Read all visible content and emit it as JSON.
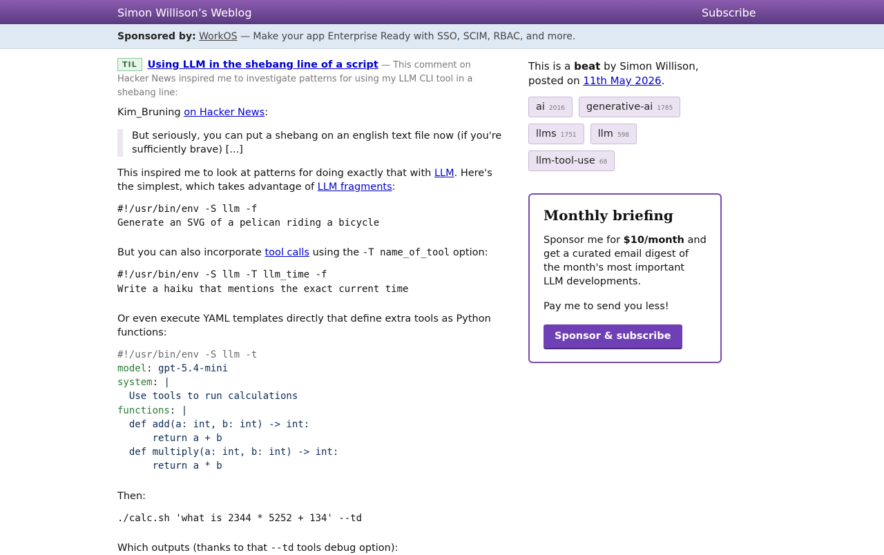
{
  "header": {
    "site_title": "Simon Willison’s Weblog",
    "subscribe": "Subscribe"
  },
  "sponsor_bar": {
    "label": "Sponsored by:",
    "sponsor": "WorkOS",
    "text": " — Make your app Enterprise Ready with SSO, SCIM, RBAC, and more."
  },
  "post": {
    "badge": "TIL",
    "title": "Using LLM in the shebang line of a script",
    "summary": " — This comment on Hacker News inspired me to investigate patterns for using my LLM CLI tool in a shebang line:",
    "source_author": "Kim_Bruning",
    "source_link": "on Hacker News",
    "quote": "But seriously, you can put a shebang on an english text file now (if you're sufficiently brave) [...]",
    "p1_a": "This inspired me to look at patterns for doing exactly that with ",
    "p1_link1": "LLM",
    "p1_b": ". Here's the simplest, which takes advantage of ",
    "p1_link2": "LLM fragments",
    "p1_c": ":",
    "code1": "#!/usr/bin/env -S llm -f\nGenerate an SVG of a pelican riding a bicycle",
    "p2_a": "But you can also incorporate ",
    "p2_link": "tool calls",
    "p2_b": " using the ",
    "p2_code": "-T name_of_tool",
    "p2_c": " option:",
    "code2": "#!/usr/bin/env -S llm -T llm_time -f\nWrite a haiku that mentions the exact current time",
    "p3": "Or even execute YAML templates directly that define extra tools as Python functions:",
    "code3": {
      "shebang": "#!/usr/bin/env -S llm -t",
      "model_key": "model",
      "model_val": "gpt-5.4-mini",
      "system_key": "system",
      "system_val": "|",
      "system_body": "  Use tools to run calculations",
      "functions_key": "functions",
      "functions_val": "|",
      "fn_body": "  def add(a: int, b: int) -> int:\n      return a + b\n  def multiply(a: int, b: int) -> int:\n      return a * b"
    },
    "p4": "Then:",
    "code4": "./calc.sh 'what is 2344 * 5252 + 134' --td",
    "p5_a": "Which outputs (thanks to that ",
    "p5_code": "--td",
    "p5_b": " tools debug option):"
  },
  "sidebar": {
    "beat_a": "This is a ",
    "beat_b": "beat",
    "beat_c": " by Simon Willison, posted on ",
    "date": "11th May 2026",
    "beat_d": ".",
    "tags": [
      {
        "label": "ai",
        "count": "2016"
      },
      {
        "label": "generative-ai",
        "count": "1785"
      },
      {
        "label": "llms",
        "count": "1751"
      },
      {
        "label": "llm",
        "count": "598"
      },
      {
        "label": "llm-tool-use",
        "count": "68"
      }
    ],
    "briefing": {
      "title": "Monthly briefing",
      "text_a": "Sponsor me for ",
      "text_b": "$10/month",
      "text_c": " and get a curated email digest of the month's most important LLM developments.",
      "pay": "Pay me to send you less!",
      "button": "Sponsor & subscribe"
    }
  },
  "colors": {
    "header_top": "#8c5cb0",
    "header_bottom": "#5a3a80",
    "accent": "#6f3fb6",
    "sponsor_bar_bg": "#dfe9f3"
  }
}
